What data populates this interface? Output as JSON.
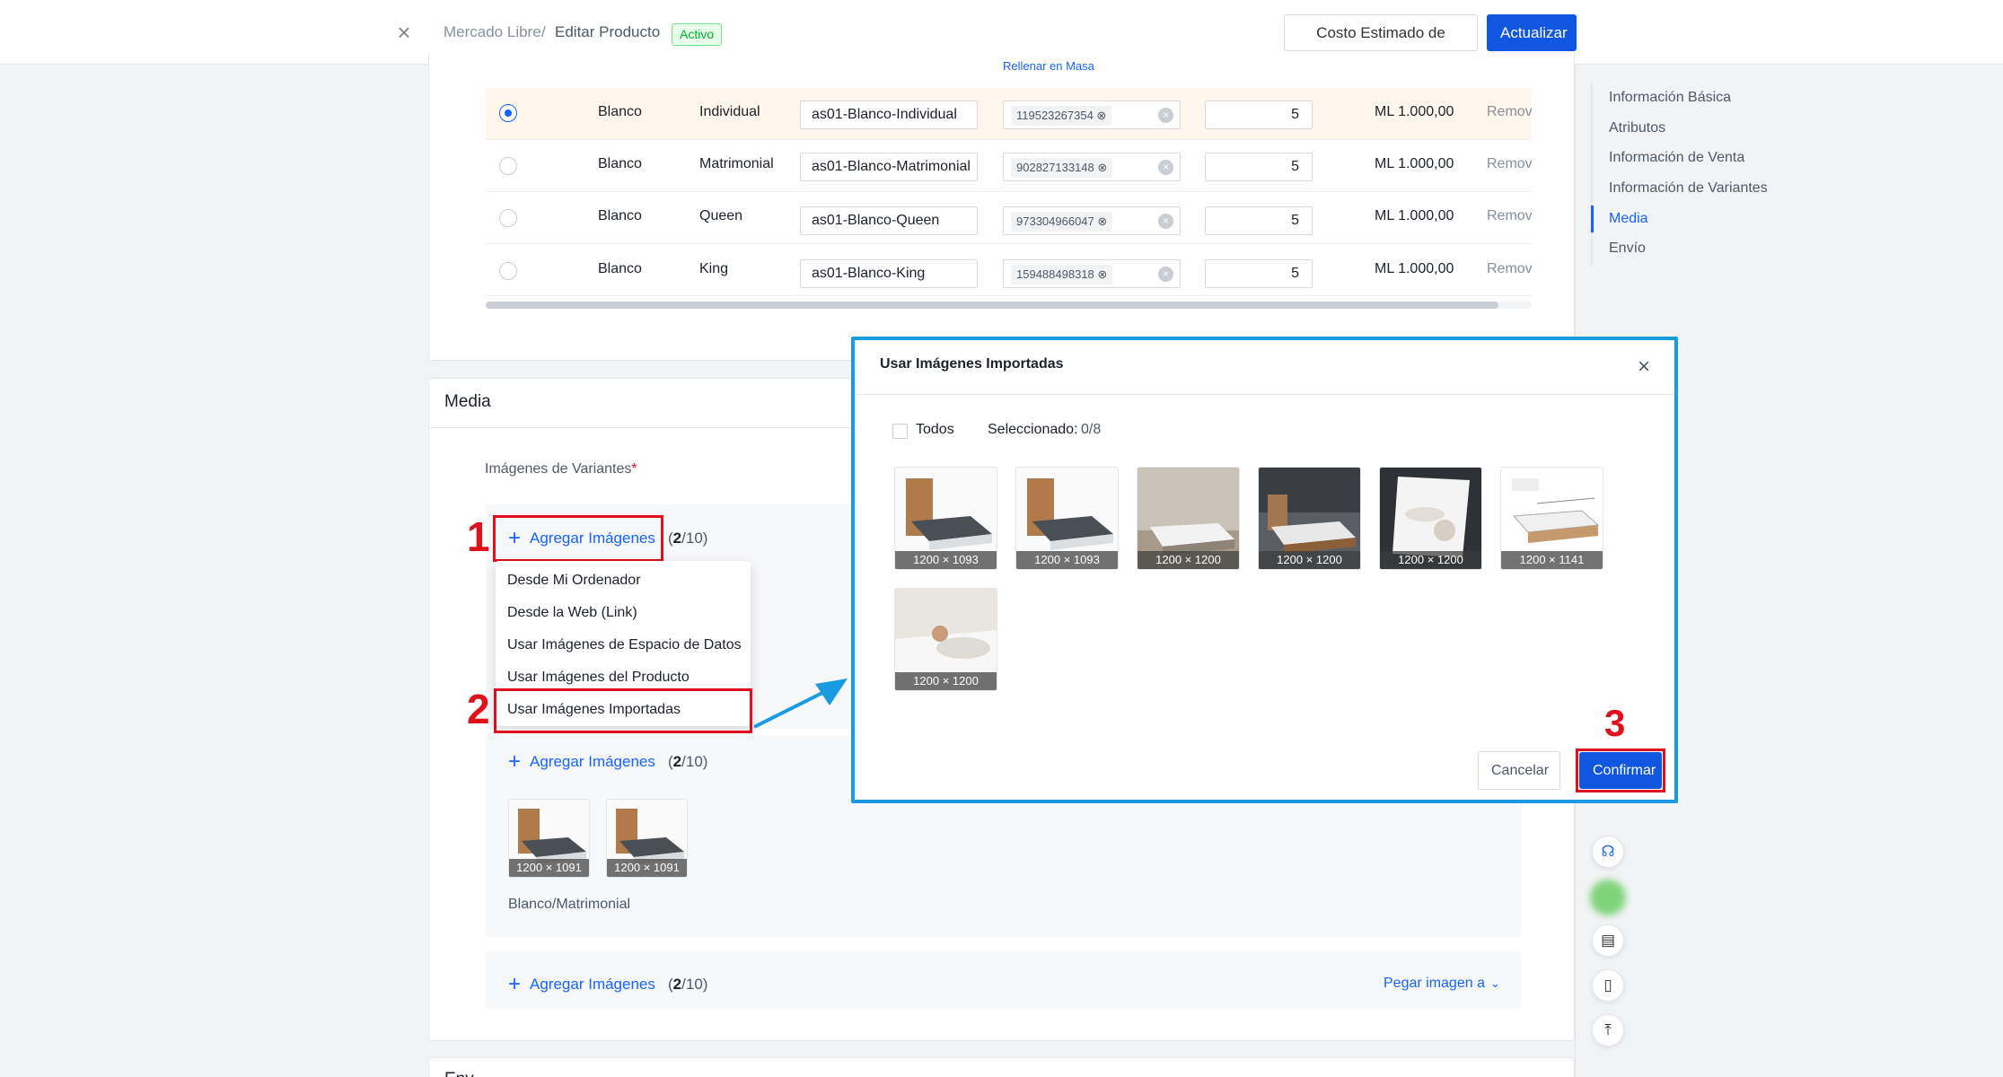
{
  "header": {
    "breadcrumb_root": "Mercado Libre",
    "breadcrumb_sep": "/",
    "breadcrumb_current": "Editar Producto",
    "status_badge": "Activo",
    "estimate_button": "Costo Estimado de Ventas",
    "update_button": "Actualizar"
  },
  "anchor_nav": {
    "items": [
      "Información Básica",
      "Atributos",
      "Información de Venta",
      "Información de Variantes",
      "Media",
      "Envío"
    ],
    "active": "Media"
  },
  "variants_table": {
    "bulk_fill_link": "Rellenar en Masa",
    "rows": [
      {
        "selected": true,
        "color": "Blanco",
        "size": "Individual",
        "sku": "as01-Blanco-Individual",
        "gtin": "119523267354",
        "qty": "5",
        "price": "ML 1.000,00",
        "action": "Remov"
      },
      {
        "selected": false,
        "color": "Blanco",
        "size": "Matrimonial",
        "sku": "as01-Blanco-Matrimonial",
        "gtin": "902827133148",
        "qty": "5",
        "price": "ML 1.000,00",
        "action": "Remov"
      },
      {
        "selected": false,
        "color": "Blanco",
        "size": "Queen",
        "sku": "as01-Blanco-Queen",
        "gtin": "973304966047",
        "qty": "5",
        "price": "ML 1.000,00",
        "action": "Remov"
      },
      {
        "selected": false,
        "color": "Blanco",
        "size": "King",
        "sku": "as01-Blanco-King",
        "gtin": "159488498318",
        "qty": "5",
        "price": "ML 1.000,00",
        "action": "Remov"
      }
    ]
  },
  "media": {
    "section_title": "Media",
    "variant_images_label": "Imágenes de Variantes",
    "required_mark": "*",
    "add_images_label": "Agregar Imágenes",
    "counter_open": "(",
    "counter_value": "2",
    "counter_close": "/10)",
    "dropdown": [
      "Desde Mi Ordenador",
      "Desde la Web (Link)",
      "Usar Imágenes de Espacio de Datos",
      "Usar Imágenes del Producto",
      "Usar Imágenes Importadas"
    ],
    "variant_thumbs": [
      {
        "dims": "1200 × 1091"
      },
      {
        "dims": "1200 × 1091"
      }
    ],
    "variant_caption": "Blanco/Matrimonial",
    "paste_image_label": "Pegar imagen a"
  },
  "modal": {
    "title": "Usar Imágenes Importadas",
    "select_all_label": "Todos",
    "selected_label": "Seleccionado:",
    "selected_count": "0/8",
    "images": [
      {
        "dims": "1200 × 1093"
      },
      {
        "dims": "1200 × 1093"
      },
      {
        "dims": "1200 × 1200"
      },
      {
        "dims": "1200 × 1200"
      },
      {
        "dims": "1200 × 1200"
      },
      {
        "dims": "1200 × 1141"
      },
      {
        "dims": "1200 × 1200"
      }
    ],
    "cancel_button": "Cancelar",
    "confirm_button": "Confirmar"
  },
  "annotations": {
    "step1": "1",
    "step2": "2",
    "step3": "3",
    "highlight_color": "#e0111c",
    "arrow_color": "#1a9be0"
  },
  "partial_next_section": "Env"
}
